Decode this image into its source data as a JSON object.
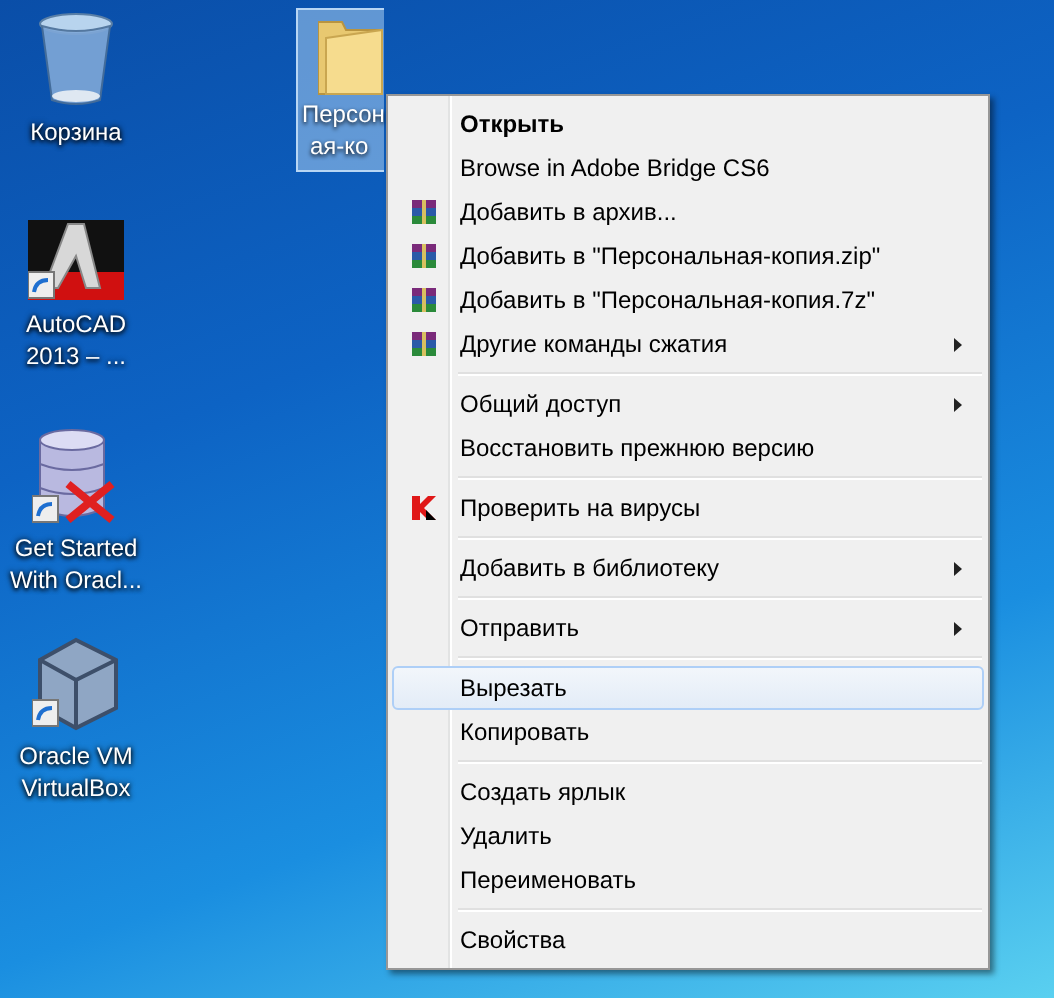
{
  "desktop_icons": [
    {
      "kind": "recycle-bin",
      "label": "Корзина",
      "shortcut": false
    },
    {
      "kind": "autocad",
      "label": "AutoCAD 2013 – ...",
      "shortcut": true
    },
    {
      "kind": "database",
      "label": "Get Started With Oracl...",
      "shortcut": true
    },
    {
      "kind": "virtualbox",
      "label": "Oracle VM VirtualBox",
      "shortcut": true
    }
  ],
  "folder": {
    "label_lines": [
      "Персон",
      "ая-ко"
    ],
    "selected": true
  },
  "context_menu": [
    {
      "kind": "item",
      "label": "Открыть",
      "bold": true,
      "submenu": false,
      "selected": false
    },
    {
      "kind": "item",
      "label": "Browse in Adobe Bridge CS6",
      "bold": false,
      "submenu": false,
      "selected": false
    },
    {
      "kind": "archive",
      "label": "Добавить в архив...",
      "bold": false,
      "submenu": false,
      "selected": false
    },
    {
      "kind": "archive",
      "label": "Добавить в \"Персональная-копия.zip\"",
      "bold": false,
      "submenu": false,
      "selected": false
    },
    {
      "kind": "archive",
      "label": "Добавить в \"Персональная-копия.7z\"",
      "bold": false,
      "submenu": false,
      "selected": false
    },
    {
      "kind": "archive",
      "label": "Другие команды сжатия",
      "bold": false,
      "submenu": true,
      "selected": false
    },
    {
      "kind": "separator"
    },
    {
      "kind": "item",
      "label": "Общий доступ",
      "bold": false,
      "submenu": true,
      "selected": false
    },
    {
      "kind": "item",
      "label": "Восстановить прежнюю версию",
      "bold": false,
      "submenu": false,
      "selected": false
    },
    {
      "kind": "separator"
    },
    {
      "kind": "antivirus",
      "label": "Проверить на вирусы",
      "bold": false,
      "submenu": false,
      "selected": false
    },
    {
      "kind": "separator"
    },
    {
      "kind": "item",
      "label": "Добавить в библиотеку",
      "bold": false,
      "submenu": true,
      "selected": false
    },
    {
      "kind": "separator"
    },
    {
      "kind": "item",
      "label": "Отправить",
      "bold": false,
      "submenu": true,
      "selected": false
    },
    {
      "kind": "separator"
    },
    {
      "kind": "item",
      "label": "Вырезать",
      "bold": false,
      "submenu": false,
      "selected": true
    },
    {
      "kind": "item",
      "label": "Копировать",
      "bold": false,
      "submenu": false,
      "selected": false
    },
    {
      "kind": "separator"
    },
    {
      "kind": "item",
      "label": "Создать ярлык",
      "bold": false,
      "submenu": false,
      "selected": false
    },
    {
      "kind": "item",
      "label": "Удалить",
      "bold": false,
      "submenu": false,
      "selected": false
    },
    {
      "kind": "item",
      "label": "Переименовать",
      "bold": false,
      "submenu": false,
      "selected": false
    },
    {
      "kind": "separator"
    },
    {
      "kind": "item",
      "label": "Свойства",
      "bold": false,
      "submenu": false,
      "selected": false
    }
  ]
}
